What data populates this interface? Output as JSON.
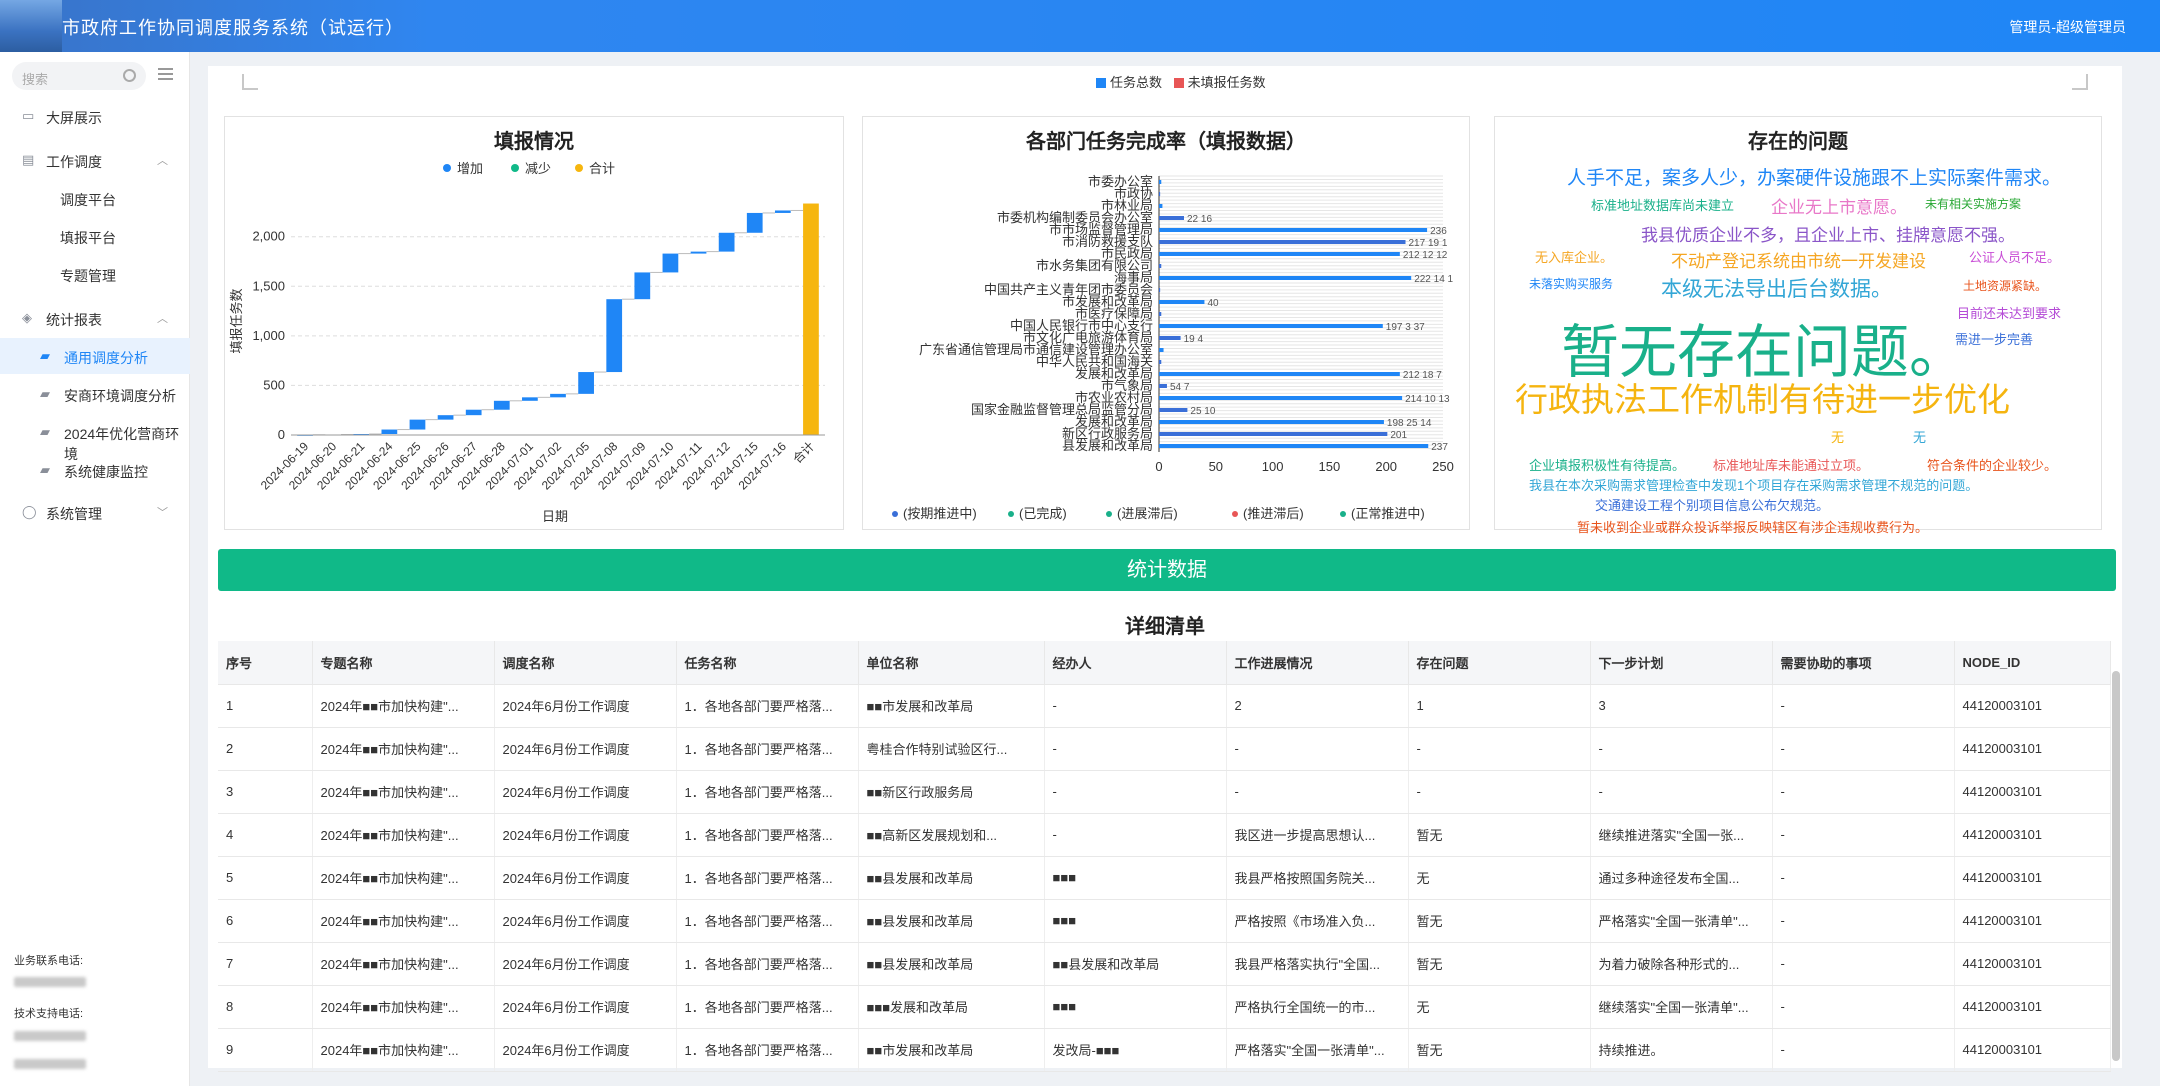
{
  "header": {
    "title": "市政府工作协同调度服务系统（试运行）",
    "user": "管理员-超级管理员"
  },
  "sidebar": {
    "search_placeholder": "搜索",
    "items": [
      {
        "label": "大屏展示",
        "icon": "monitor-icon"
      },
      {
        "label": "工作调度",
        "icon": "document-icon",
        "expanded": true
      },
      {
        "label": "调度平台"
      },
      {
        "label": "填报平台"
      },
      {
        "label": "专题管理"
      },
      {
        "label": "统计报表",
        "icon": "stack-icon",
        "expanded": true
      },
      {
        "label": "通用调度分析",
        "icon": "briefcase-icon",
        "active": true
      },
      {
        "label": "安商环境调度分析",
        "icon": "briefcase-icon"
      },
      {
        "label": "2024年优化营商环境",
        "icon": "briefcase-icon"
      },
      {
        "label": "系统健康监控",
        "icon": "briefcase-icon"
      },
      {
        "label": "系统管理",
        "icon": "user-icon"
      }
    ],
    "contact": {
      "business_label": "业务联系电话:",
      "tech_label": "技术支持电话:"
    }
  },
  "top_legend": {
    "total": "任务总数",
    "unfilled": "未填报任务数",
    "colors": {
      "total": "#1f86f6",
      "unfilled": "#e85656"
    }
  },
  "panels": {
    "fill": "填报情况",
    "dept": "各部门任务完成率（填报数据）",
    "issues": "存在的问题"
  },
  "chart_data": [
    {
      "type": "bar",
      "subtype": "waterfall",
      "title": "填报情况",
      "xlabel": "日期",
      "ylabel": "填报任务数",
      "ylim": [
        0,
        2300
      ],
      "yticks": [
        "0",
        "500",
        "1,000",
        "1,500",
        "2,000"
      ],
      "legend": [
        "增加",
        "减少",
        "合计"
      ],
      "colors": {
        "increase": "#1f86f6",
        "decrease": "#10b988",
        "total": "#f6b60f"
      },
      "categories": [
        "2024-06-19",
        "2024-06-20",
        "2024-06-21",
        "2024-06-24",
        "2024-06-25",
        "2024-06-26",
        "2024-06-27",
        "2024-06-28",
        "2024-07-01",
        "2024-07-02",
        "2024-07-05",
        "2024-07-08",
        "2024-07-09",
        "2024-07-10",
        "2024-07-11",
        "2024-07-12",
        "2024-07-15",
        "2024-07-16",
        "合计"
      ],
      "bases": [
        0,
        2,
        5,
        10,
        55,
        155,
        200,
        255,
        345,
        380,
        415,
        635,
        1370,
        1640,
        1830,
        1850,
        2040,
        2240,
        0
      ],
      "values": [
        2,
        3,
        5,
        45,
        100,
        45,
        55,
        90,
        35,
        35,
        220,
        735,
        270,
        190,
        20,
        190,
        200,
        25,
        2335
      ]
    },
    {
      "type": "bar",
      "orientation": "horizontal",
      "title": "各部门任务完成率（填报数据）",
      "xlim": [
        0,
        250
      ],
      "xticks": [
        "0",
        "50",
        "100",
        "150",
        "200",
        "250"
      ],
      "legend": [
        "(按期推进中)",
        "(已完成)",
        "(进展滞后)",
        "(推进滞后)",
        "(正常推进中)"
      ],
      "categories": [
        "市委办公室",
        "市政协",
        "市林业局",
        "市委机构编制委员会办公室",
        "市市场监督管理局",
        "市消防救援支队",
        "市民政局",
        "市水务集团有限公司",
        "海事局",
        "中国共产主义青年团市委员会",
        "市发展和改革局",
        "市医疗保障局",
        "中国人民银行市中心支行",
        "市文化广电旅游体育局",
        "广东省通信管理局市通信建设管理办公室",
        "中华人民共和国海关",
        "发展和改革局",
        "市气象局",
        "市农业农村局",
        "国家金融监督管理总局监管分局",
        "发展和改革局",
        "新区行政服务局",
        "县发展和改革局"
      ],
      "series": [
        {
          "name": "(按期推进中)",
          "color": "#3a6fd8"
        },
        {
          "name": "(已完成)",
          "color": "#1f86f6"
        }
      ],
      "values": [
        2,
        1,
        3,
        22,
        236,
        217,
        212,
        2,
        222,
        1,
        40,
        2,
        197,
        19,
        4,
        2,
        212,
        7,
        214,
        25,
        198,
        201,
        237
      ],
      "labels": [
        "",
        "",
        "",
        "22 16",
        "236",
        "217 19 1",
        "212 12 12",
        "",
        "222 14 1",
        "",
        "40",
        "",
        "197 3 37",
        "19 4",
        "",
        "",
        "212 18 7",
        "54 7",
        "214 10 13",
        "25 10",
        "198 25 14",
        "201",
        "237"
      ]
    }
  ],
  "word_cloud": [
    {
      "text": "人手不足，案多人少，办案硬件设施跟不上实际案件需求。",
      "color": "#1f86f6",
      "size": 19
    },
    {
      "text": "标准地址数据库尚未建立",
      "color": "#19b08a",
      "size": 13
    },
    {
      "text": "企业无上市意愿。",
      "color": "#e877c8",
      "size": 17
    },
    {
      "text": "未有相关实施方案",
      "color": "#2aa836",
      "size": 12
    },
    {
      "text": "我县优质企业不多，且企业上市、挂牌意愿不强。",
      "color": "#8a55c8",
      "size": 17
    },
    {
      "text": "无入库企业。",
      "color": "#f5a623",
      "size": 13
    },
    {
      "text": "不动产登记系统由市统一开发建设",
      "color": "#f5a623",
      "size": 17
    },
    {
      "text": "公证人员不足。",
      "color": "#c94fd6",
      "size": 13
    },
    {
      "text": "未落实购买服务",
      "color": "#1f86f6",
      "size": 12
    },
    {
      "text": "本级无法导出后台数据。",
      "color": "#33a6d6",
      "size": 21
    },
    {
      "text": "土地资源紧缺。",
      "color": "#e8541c",
      "size": 12
    },
    {
      "text": "暂无存在问题。",
      "color": "#19b08a",
      "size": 58
    },
    {
      "text": "目前还未达到要求",
      "color": "#b44ad6",
      "size": 13
    },
    {
      "text": "需进一步完善",
      "color": "#3a6fd8",
      "size": 13
    },
    {
      "text": "行政执法工作机制有待进一步优化",
      "color": "#f5b40f",
      "size": 33
    },
    {
      "text": "无",
      "color": "#f5b40f",
      "size": 13
    },
    {
      "text": "无",
      "color": "#33a6d6",
      "size": 13
    },
    {
      "text": "企业填报积极性有待提高。",
      "color": "#19b08a",
      "size": 13
    },
    {
      "text": "标准地址库未能通过立项。",
      "color": "#e85656",
      "size": 13
    },
    {
      "text": "符合条件的企业较少。",
      "color": "#e8541c",
      "size": 13
    },
    {
      "text": "我县在本次采购需求管理检查中发现1个项目存在采购需求管理不规范的问题。",
      "color": "#33a6d6",
      "size": 13
    },
    {
      "text": "交通建设工程个别项目信息公布欠规范。",
      "color": "#3a6fd8",
      "size": 13
    },
    {
      "text": "暂未收到企业或群众投诉举报反映辖区有涉企违规收费行为。",
      "color": "#e8541c",
      "size": 13
    }
  ],
  "stats_button": "统计数据",
  "detail": {
    "title": "详细清单",
    "columns": [
      "序号",
      "专题名称",
      "调度名称",
      "任务名称",
      "单位名称",
      "经办人",
      "工作进展情况",
      "存在问题",
      "下一步计划",
      "需要协助的事项",
      "NODE_ID"
    ],
    "rows": [
      [
        "1",
        "2024年■■市加快构建\"...",
        "2024年6月份工作调度",
        "1．各地各部门要严格落...",
        "■■市发展和改革局",
        "-",
        "2",
        "1",
        "3",
        "-",
        "44120003101"
      ],
      [
        "2",
        "2024年■■市加快构建\"...",
        "2024年6月份工作调度",
        "1．各地各部门要严格落...",
        "粤桂合作特别试验区行...",
        "-",
        "-",
        "-",
        "-",
        "-",
        "44120003101"
      ],
      [
        "3",
        "2024年■■市加快构建\"...",
        "2024年6月份工作调度",
        "1．各地各部门要严格落...",
        "■■新区行政服务局",
        "-",
        "-",
        "-",
        "-",
        "-",
        "44120003101"
      ],
      [
        "4",
        "2024年■■市加快构建\"...",
        "2024年6月份工作调度",
        "1．各地各部门要严格落...",
        "■■高新区发展规划和...",
        "-",
        "我区进一步提高思想认...",
        "暂无",
        "继续推进落实\"全国一张...",
        "-",
        "44120003101"
      ],
      [
        "5",
        "2024年■■市加快构建\"...",
        "2024年6月份工作调度",
        "1．各地各部门要严格落...",
        "■■县发展和改革局",
        "■■■",
        "我县严格按照国务院关...",
        "无",
        "通过多种途径发布全国...",
        "-",
        "44120003101"
      ],
      [
        "6",
        "2024年■■市加快构建\"...",
        "2024年6月份工作调度",
        "1．各地各部门要严格落...",
        "■■县发展和改革局",
        "■■■",
        "严格按照《市场准入负...",
        "暂无",
        "严格落实\"全国一张清单\"...",
        "-",
        "44120003101"
      ],
      [
        "7",
        "2024年■■市加快构建\"...",
        "2024年6月份工作调度",
        "1．各地各部门要严格落...",
        "■■县发展和改革局",
        "■■县发展和改革局",
        "我县严格落实执行\"全国...",
        "暂无",
        "为着力破除各种形式的...",
        "-",
        "44120003101"
      ],
      [
        "8",
        "2024年■■市加快构建\"...",
        "2024年6月份工作调度",
        "1．各地各部门要严格落...",
        "■■■发展和改革局",
        "■■■",
        "严格执行全国统一的市...",
        "无",
        "继续落实\"全国一张清单\"...",
        "-",
        "44120003101"
      ],
      [
        "9",
        "2024年■■市加快构建\"...",
        "2024年6月份工作调度",
        "1．各地各部门要严格落...",
        "■■市发展和改革局",
        "发改局-■■■",
        "严格落实\"全国一张清单\"...",
        "暂无",
        "持续推进。",
        "-",
        "44120003101"
      ]
    ]
  }
}
